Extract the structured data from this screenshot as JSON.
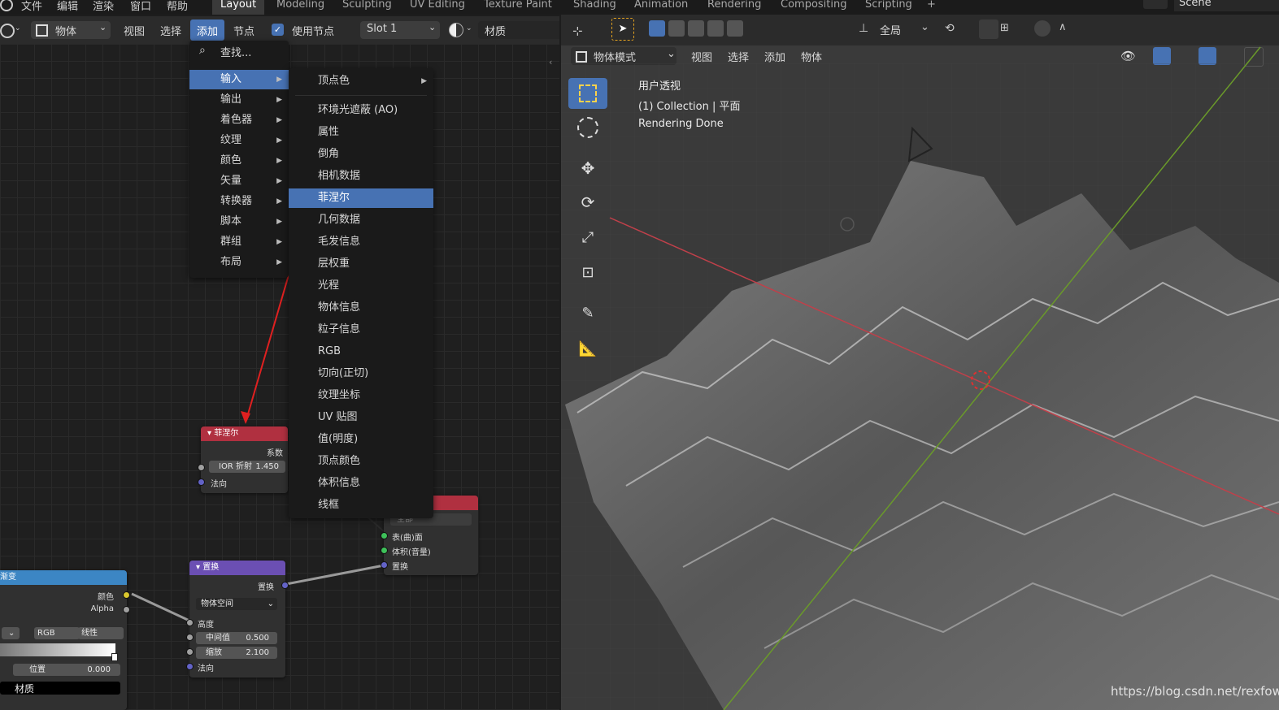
{
  "topbar": {
    "menus": [
      "文件",
      "编辑",
      "渲染",
      "窗口",
      "帮助"
    ],
    "workspaces": [
      "Layout",
      "Modeling",
      "Sculpting",
      "UV Editing",
      "Texture Paint",
      "Shading",
      "Animation",
      "Rendering",
      "Compositing",
      "Scripting"
    ],
    "active_workspace": "Layout",
    "add_tab": "+",
    "scene": "Scene"
  },
  "node_header": {
    "object_type": "物体",
    "menus": [
      "视图",
      "选择",
      "添加",
      "节点"
    ],
    "use_nodes_label": "使用节点",
    "slot": "Slot 1",
    "material": "材质"
  },
  "add_menu": {
    "search": "查找...",
    "categories": [
      "输入",
      "输出",
      "着色器",
      "纹理",
      "颜色",
      "矢量",
      "转换器",
      "脚本",
      "群组",
      "布局"
    ],
    "selected": "输入"
  },
  "input_submenu": {
    "items": [
      "顶点色",
      "环境光遮蔽 (AO)",
      "属性",
      "倒角",
      "相机数据",
      "菲涅尔",
      "几何数据",
      "毛发信息",
      "层权重",
      "光程",
      "物体信息",
      "粒子信息",
      "RGB",
      "切向(正切)",
      "纹理坐标",
      "UV 贴图",
      "值(明度)",
      "顶点颜色",
      "体积信息",
      "线框"
    ],
    "selected": "菲涅尔"
  },
  "nodes": {
    "fresnel": {
      "title": "菲涅尔",
      "output": "系数",
      "ior_label": "IOR 折射",
      "ior_value": "1.450",
      "normal": "法向"
    },
    "output": {
      "target": "全部",
      "surface": "表(曲)面",
      "volume": "体积(音量)",
      "displacement": "置换"
    },
    "displacement": {
      "title": "置换",
      "output": "置换",
      "space": "物体空间",
      "height": "高度",
      "midlevel_label": "中间值",
      "midlevel_value": "0.500",
      "scale_label": "缩放",
      "scale_value": "2.100",
      "normal": "法向"
    },
    "colorramp": {
      "title": "渐变",
      "color": "颜色",
      "alpha": "Alpha",
      "mode": "RGB",
      "interp": "线性",
      "pos_label": "位置",
      "pos_value": "0.000",
      "material": "材质"
    }
  },
  "viewport_header": {
    "transform": "全局",
    "mode": "物体模式",
    "menus": [
      "视图",
      "选择",
      "添加",
      "物体"
    ]
  },
  "viewport_info": {
    "line1": "用户透视",
    "line2": "(1) Collection | 平面",
    "line3": "Rendering Done"
  },
  "watermark": "https://blog.csdn.net/rexfow",
  "colors": {
    "accent": "#4772b3",
    "fresnel_header": "#b03040",
    "disp_header": "#6b4fb3",
    "ramp_header": "#3c86c4",
    "output_header": "#b03040"
  }
}
